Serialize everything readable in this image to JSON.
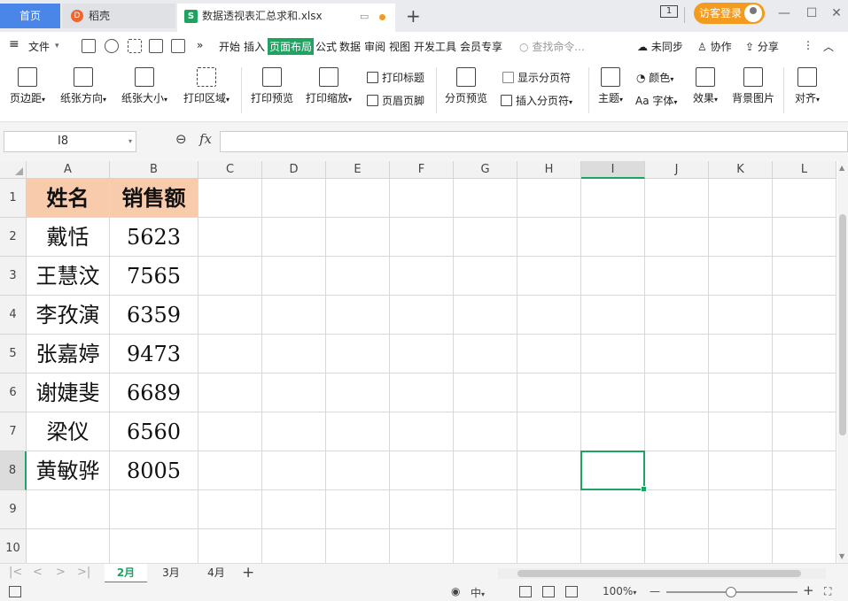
{
  "tabs": {
    "home": "首页",
    "daoke": "稻壳",
    "daoke_icon": "D",
    "file": "数据透视表汇总求和.xlsx",
    "file_icon": "S",
    "new_tab": "+"
  },
  "titlebar": {
    "page_badge": "1",
    "login_label": "访客登录",
    "minimize": "—",
    "restore": "☐",
    "close": "✕"
  },
  "menu": {
    "hamburger": "≡",
    "file": "文件",
    "more": "»",
    "items": [
      "开始",
      "插入",
      "页面布局",
      "公式",
      "数据",
      "审阅",
      "视图",
      "开发工具",
      "会员专享"
    ],
    "active_index": 2,
    "search_placeholder": "查找命令...",
    "sync": "未同步",
    "collab": "协作",
    "share": "分享",
    "more_icon": "⋮",
    "collapse_icon": "︿"
  },
  "ribbon": {
    "margin": "页边距",
    "orientation": "纸张方向",
    "size": "纸张大小",
    "print_area": "打印区域",
    "print_preview": "打印预览",
    "print_scale": "打印缩放",
    "print_title": "打印标题",
    "header_footer": "页眉页脚",
    "page_break_preview": "分页预览",
    "show_page_break": "显示分页符",
    "insert_page_break": "插入分页符",
    "theme": "主题",
    "colors": "颜色",
    "fonts": "字体",
    "fonts_prefix": "Aa",
    "effects": "效果",
    "background": "背景图片",
    "align": "对齐",
    "caret": "▾"
  },
  "formula_bar": {
    "name_box": "I8",
    "zoom_icon": "⊖",
    "fx": "fx",
    "formula": ""
  },
  "sheet": {
    "columns": [
      "A",
      "B",
      "C",
      "D",
      "E",
      "F",
      "G",
      "H",
      "I",
      "J",
      "K",
      "L"
    ],
    "rows": [
      "1",
      "2",
      "3",
      "4",
      "5",
      "6",
      "7",
      "8",
      "9",
      "10"
    ],
    "selected_col": "I",
    "selected_row": "8",
    "data": [
      [
        "姓名",
        "销售额"
      ],
      [
        "戴恬",
        "5623"
      ],
      [
        "王慧汶",
        "7565"
      ],
      [
        "李孜演",
        "6359"
      ],
      [
        "张嘉婷",
        "9473"
      ],
      [
        "谢婕斐",
        "6689"
      ],
      [
        "梁仪",
        "6560"
      ],
      [
        "黄敏骅",
        "8005"
      ]
    ],
    "header_fill": "#f8cbad",
    "accent": "#1ea362"
  },
  "sheet_tabs": {
    "items": [
      "2月",
      "3月",
      "4月"
    ],
    "active_index": 0,
    "add": "+",
    "nav_first": "|<",
    "nav_prev": "<",
    "nav_next": ">",
    "nav_last": ">|"
  },
  "status": {
    "zoom": "100%",
    "zoom_minus": "—",
    "zoom_plus": "+",
    "input_mode": "中",
    "caret": "▾",
    "fullscreen": "⛶"
  }
}
